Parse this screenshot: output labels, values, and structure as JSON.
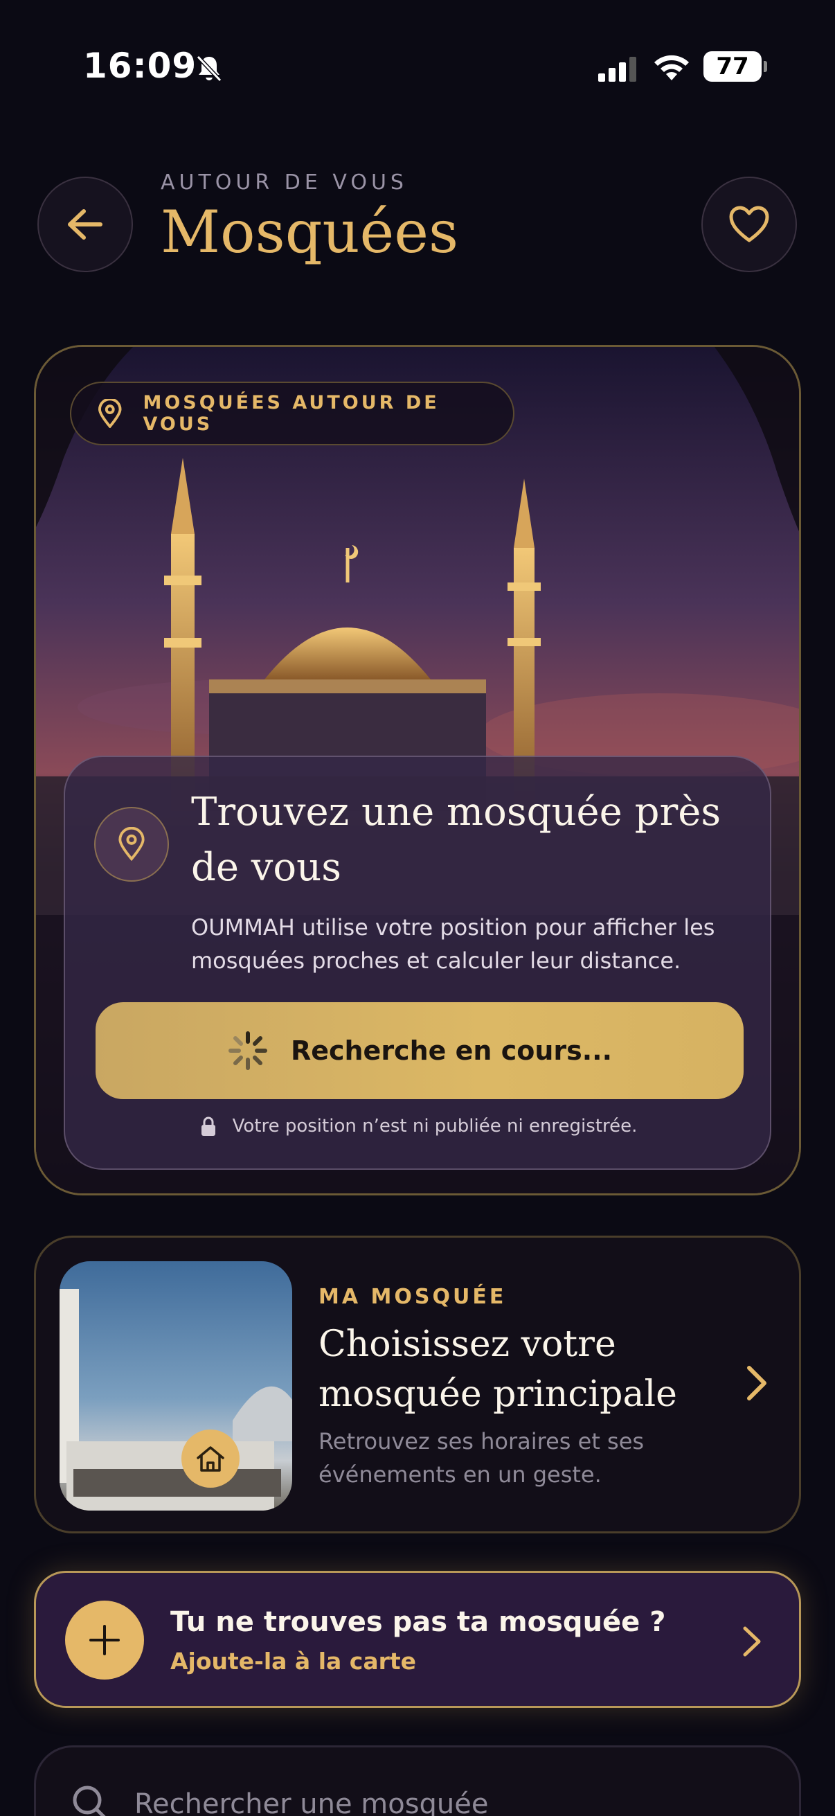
{
  "status_bar": {
    "time": "16:09",
    "battery": "77"
  },
  "header": {
    "eyebrow": "AUTOUR DE VOUS",
    "title": "Mosquées"
  },
  "hero": {
    "pill_label": "MOSQUÉES AUTOUR DE VOUS",
    "title": "Trouvez une mosquée près de vous",
    "description": "OUMMAH utilise votre position pour afficher les mosquées proches et calculer leur distance.",
    "button_label": "Recherche en cours...",
    "privacy_note": "Votre position n’est ni publiée ni enregistrée."
  },
  "my_mosque": {
    "eyebrow": "MA MOSQUÉE",
    "title": "Choisissez votre mosquée principale",
    "description": "Retrouvez ses horaires et ses événements en un geste."
  },
  "add_mosque": {
    "title": "Tu ne trouves pas ta mosquée ?",
    "subtitle": "Ajoute-la à la carte"
  },
  "search": {
    "placeholder": "Rechercher une mosquée"
  },
  "colors": {
    "accent": "#e5b868",
    "background": "#0b0a14",
    "banner": "#2a1a3c"
  }
}
